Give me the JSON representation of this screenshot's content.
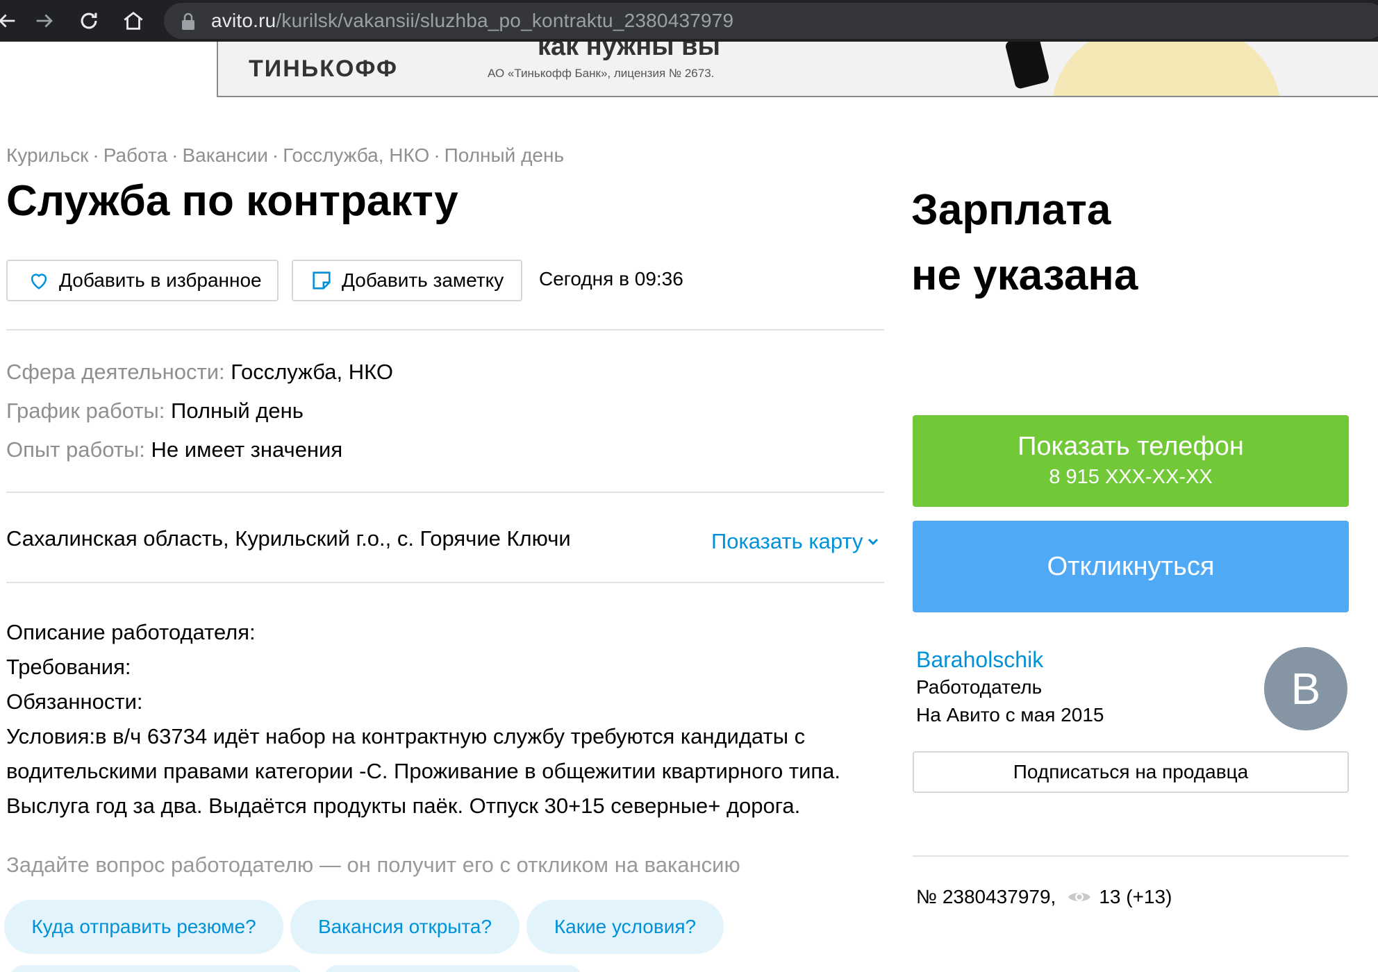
{
  "browser": {
    "url_host": "avito.ru",
    "url_path": "/kurilsk/vakansii/sluzhba_po_kontraktu_2380437979"
  },
  "banner": {
    "top_text": "как нужны вы",
    "logo": "ТИНЬКОФФ",
    "license": "АО «Тинькофф Банк», лицензия № 2673."
  },
  "breadcrumb": [
    "Курильск",
    "Работа",
    "Вакансии",
    "Госслужба, НКО",
    "Полный день"
  ],
  "breadcrumb_sep": "·",
  "title": "Служба по контракту",
  "actions": {
    "favorite_label": "Добавить в избранное",
    "note_label": "Добавить заметку",
    "date": "Сегодня в 09:36"
  },
  "params": [
    {
      "key": "Сфера деятельности:",
      "value": "Госслужба, НКО"
    },
    {
      "key": "График работы:",
      "value": "Полный день"
    },
    {
      "key": "Опыт работы:",
      "value": "Не имеет значения"
    }
  ],
  "location": {
    "address": "Сахалинская область, Курильский г.о., с. Горячие Ключи",
    "show_map_label": "Показать карту"
  },
  "description": {
    "employer": "Описание работодателя:",
    "requirements": "Требования:",
    "duties": "Обязанности:",
    "conditions_lines": [
      "Условия:в в/ч 63734 идёт набор на контрактную службу требуются кандидаты с",
      "водительскими правами категории -С. Проживание в общежитии квартирного типа.",
      "Выслуга год за два. Выдаётся продукты паёк. Отпуск 30+15 северные+ дорога."
    ]
  },
  "ask": {
    "hint": "Задайте вопрос работодателю — он получит его с откликом на вакансию",
    "chips": [
      "Куда отправить резюме?",
      "Вакансия открыта?",
      "Какие условия?"
    ]
  },
  "sidebar": {
    "salary_line1": "Зарплата",
    "salary_line2": "не указана",
    "phone_button_label": "Показать телефон",
    "phone_masked": "8 915 XXX-XX-XX",
    "respond_button_label": "Откликнуться",
    "seller_name": "Baraholschik",
    "seller_role": "Работодатель",
    "seller_since": "На Авито с мая 2015",
    "avatar_letter": "B",
    "subscribe_label": "Подписаться на продавца",
    "item_number": "№ 2380437979,",
    "views": "13 (+13)"
  },
  "colors": {
    "phone_button": "#72c938",
    "respond_button": "#4fa9f4",
    "link": "#0091d9",
    "muted_text": "#8f8f8f",
    "chip_bg": "#e3f3fb",
    "avatar_bg": "#8595a3"
  }
}
